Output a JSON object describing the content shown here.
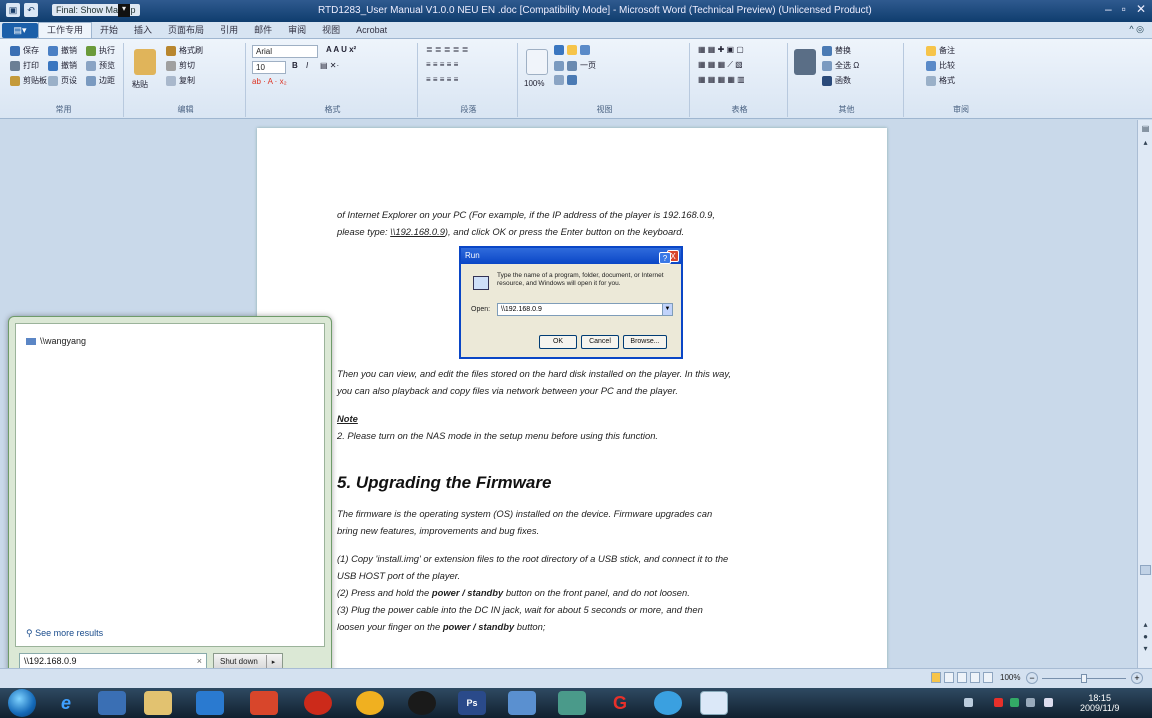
{
  "window": {
    "doc_mode": "Final: Show Markup",
    "title": "RTD1283_User Manual V1.0.0 NEU EN .doc [Compatibility Mode] - Microsoft Word (Technical Preview) (Unlicensed Product)"
  },
  "ribbon": {
    "tabs": [
      "工作专用",
      "开始",
      "插入",
      "页面布局",
      "引用",
      "邮件",
      "审阅",
      "视图",
      "Acrobat"
    ],
    "active_tab": "工作专用",
    "groups": {
      "common_label": "常用",
      "edit_label": "编辑",
      "format_label": "格式",
      "para_label": "段落",
      "view_label": "视图",
      "table_label": "表格",
      "other_label": "其他",
      "review_label": "审阅"
    },
    "common": {
      "save": "保存",
      "undo": "撤销",
      "exec": "执行",
      "print": "打印",
      "redo": "撤销",
      "preview": "预览",
      "clip": "剪贴板",
      "page": "页设",
      "bottom": "边距"
    },
    "edit": {
      "paint": "格式刷",
      "cut": "剪切",
      "copy": "复制",
      "paste": "粘贴"
    },
    "format": {
      "font": "Arial",
      "size": "10"
    },
    "view": {
      "zoom": "100%",
      "one_page": "一页"
    },
    "other": {
      "replace": "替换",
      "select_all": "全选",
      "func": "函数"
    },
    "review": {
      "comment": "备注",
      "compare": "比较",
      "style": "格式"
    }
  },
  "document": {
    "p1": "of Internet Explorer on your PC (For example, if the IP address of the player is 192.168.0.9,",
    "p2a": "please type: ",
    "p2_link": "\\\\192.168.0.9",
    "p2b": "), and click OK or press the Enter button on the keyboard.",
    "p3": "Then you can view, and edit the files stored on the hard disk installed on the player. In this way,",
    "p4": "you can also playback and copy files via network between  your PC and the player.",
    "note_title": "Note",
    "note": "2. Please turn on the NAS mode in the setup menu before using this function.",
    "heading": "5. Upgrading the Firmware",
    "fw1": "The firmware is the operating system (OS) installed on the device. Firmware upgrades can",
    "fw2": "bring new features, improvements and bug fixes.",
    "s1a": "(1) Copy 'install.img' or extension files to the root directory of a USB stick, and connect it to the",
    "s1b": "USB HOST port of the player.",
    "s2a": "(2) Press and hold the ",
    "s2b": "power / standby",
    "s2c": " button on the front panel, and do not loosen.",
    "s3a": "(3) Plug the power cable into the DC IN jack, wait for about 5 seconds or more, and then",
    "s3b": "loosen your finger on the ",
    "s3c": "power / standby",
    "s3d": " button;"
  },
  "run_dialog": {
    "title": "Run",
    "help": "?",
    "close": "X",
    "text": "Type the name of a program, folder, document, or Internet resource, and Windows will open it for you.",
    "open_label": "Open:",
    "open_value": "\\\\192.168.0.9",
    "ok": "OK",
    "cancel": "Cancel",
    "browse": "Browse..."
  },
  "start_menu": {
    "user_item": "\\\\wangyang",
    "see_more": "See more results",
    "search_value": "\\\\192.168.0.9",
    "clear": "×",
    "shutdown": "Shut down"
  },
  "statusbar": {
    "zoom": "100%"
  },
  "taskbar": {
    "apps": [
      "ie",
      "ps",
      "word"
    ],
    "ps_label": "Ps",
    "time": "18:15",
    "date": "2009/11/9"
  },
  "colors": {
    "accent": "#1b5fa9",
    "title_gradient_top": "#2f5a8f",
    "run_title": "#0a46c6"
  }
}
